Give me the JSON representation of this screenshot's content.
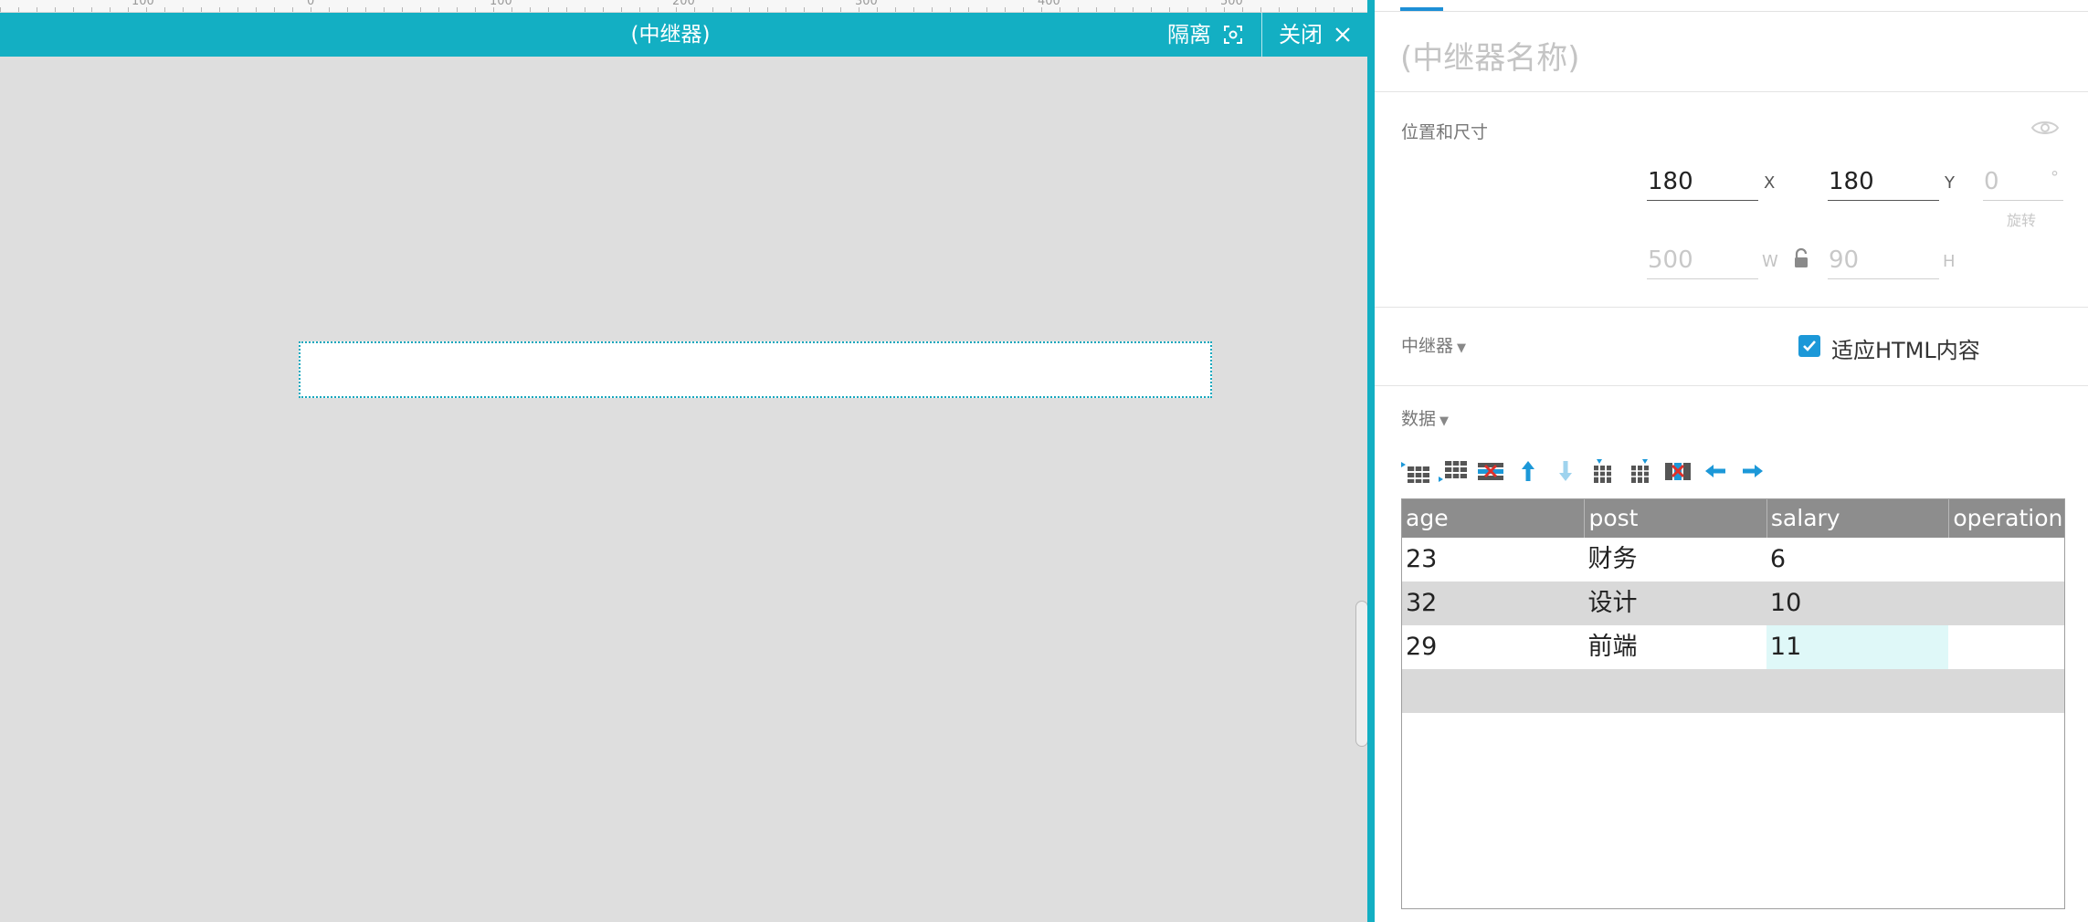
{
  "ruler": {
    "numbers": [
      "100",
      "0",
      "100",
      "200",
      "300",
      "400",
      "500"
    ]
  },
  "editor": {
    "title": "(中继器)",
    "isolate_label": "隔离",
    "close_label": "关闭"
  },
  "panel": {
    "name_placeholder": "(中继器名称)",
    "position_section": "位置和尺寸",
    "x_value": "180",
    "x_label": "X",
    "y_value": "180",
    "y_label": "Y",
    "rotation_value": "0",
    "rotation_unit": "°",
    "rotation_caption": "旋转",
    "w_value": "500",
    "w_label": "W",
    "h_value": "90",
    "h_label": "H",
    "repeater_section": "中继器",
    "fit_html_label": "适应HTML内容",
    "fit_html_checked": true,
    "data_section": "数据"
  },
  "toolbar_icons": [
    "insert-row-above-icon",
    "insert-row-below-icon",
    "delete-row-icon",
    "move-up-icon",
    "move-down-icon",
    "insert-column-left-icon",
    "insert-column-right-icon",
    "delete-column-icon",
    "move-left-icon",
    "move-right-icon"
  ],
  "table": {
    "columns": [
      "age",
      "post",
      "salary",
      "operation"
    ],
    "rows": [
      [
        "23",
        "财务",
        "6",
        ""
      ],
      [
        "32",
        "设计",
        "10",
        ""
      ],
      [
        "29",
        "前端",
        "11",
        ""
      ]
    ]
  },
  "colors": {
    "accent": "#13afc3",
    "canvas": "#dedede",
    "header_grey": "#8d8d8d",
    "icon_blue": "#1c98d8"
  }
}
